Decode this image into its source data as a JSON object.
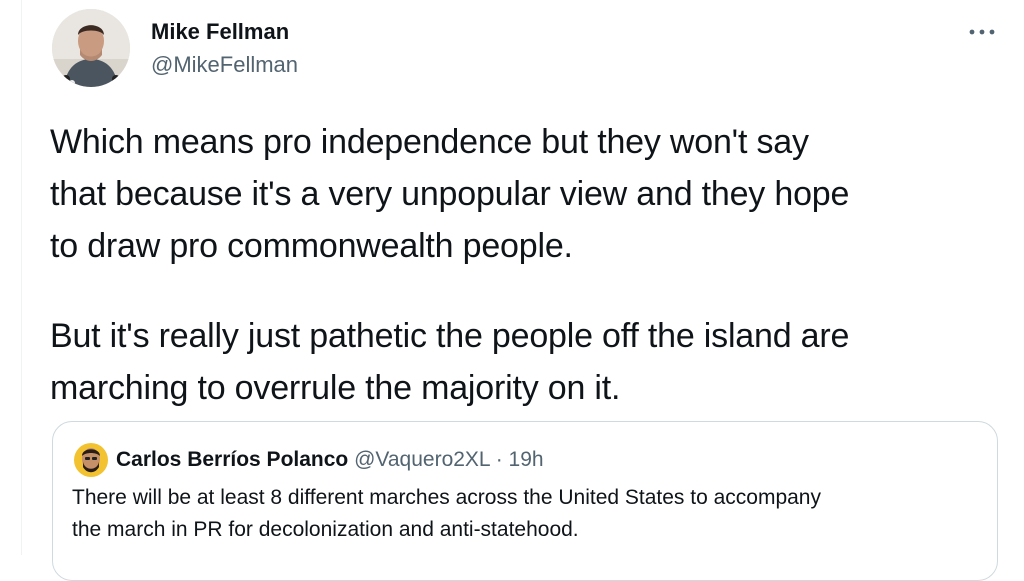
{
  "author": {
    "name": "Mike Fellman",
    "handle": "@MikeFellman",
    "avatar_icon": "profile-photo"
  },
  "more_icon": "more-horizontal-icon",
  "tweet": {
    "paragraph1": [
      "Which means pro independence but they won't say",
      "that because it's a very unpopular view and they hope",
      "to draw pro commonwealth people."
    ],
    "paragraph2": [
      "But it's really just pathetic the people off the island are",
      "marching to overrule the majority on it."
    ]
  },
  "quote": {
    "name": "Carlos Berríos Polanco",
    "handle": "@Vaquero2XL",
    "separator": "·",
    "time": "19h",
    "text": [
      "There will be at least 8 different marches across the United States to accompany",
      "the march in PR for decolonization and anti-statehood."
    ]
  },
  "colors": {
    "text_primary": "#0f1419",
    "text_secondary": "#536471",
    "border": "#cfd9de",
    "quote_avatar_bg": "#f2c230"
  }
}
